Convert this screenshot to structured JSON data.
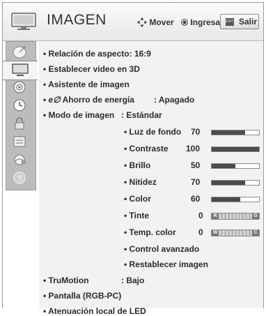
{
  "header": {
    "title": "IMAGEN",
    "move_label": "Mover",
    "enter_label": "Ingresar",
    "exit_key": "EXIT",
    "exit_label": "Salir"
  },
  "sidebar": {
    "items": [
      {
        "icon": "satellite-dish-icon"
      },
      {
        "icon": "tv-picture-icon",
        "active": true
      },
      {
        "icon": "speaker-icon"
      },
      {
        "icon": "clock-icon"
      },
      {
        "icon": "lock-icon"
      },
      {
        "icon": "input-icon"
      },
      {
        "icon": "network-icon"
      },
      {
        "icon": "help-icon",
        "glyph": "?"
      }
    ]
  },
  "menu": {
    "aspect": {
      "label": "Relación de aspecto",
      "sep": ":",
      "value": "16:9"
    },
    "video3d": {
      "label": "Establecer video en 3D"
    },
    "assistant": {
      "label": "Asistente de imagen"
    },
    "energy": {
      "glyph": "e∅",
      "label": "Ahorro de energía",
      "sep": ":",
      "value": "Apagado"
    },
    "mode": {
      "label": "Modo de imagen",
      "sep": ":",
      "value": "Estándar"
    },
    "backlight": {
      "label": "Luz de fondo",
      "value": "70",
      "level": 0.7
    },
    "contrast": {
      "label": "Contraste",
      "value": "100",
      "level": 1.0
    },
    "brightness": {
      "label": "Brillo",
      "value": "50",
      "level": 0.5
    },
    "sharpness": {
      "label": "Nitidez",
      "value": "70",
      "level": 0.7
    },
    "color": {
      "label": "Color",
      "value": "60",
      "level": 0.6
    },
    "tint": {
      "label": "Tinte",
      "value": "0",
      "left": "R",
      "right": "G"
    },
    "temp": {
      "label": "Temp. color",
      "value": "0",
      "left": "W",
      "right": "C"
    },
    "advanced": {
      "label": "Control avanzado"
    },
    "reset": {
      "label": "Restablecer imagen"
    },
    "trumotion": {
      "label": "TruMotion",
      "sep": ":",
      "value": "Bajo"
    },
    "screen": {
      "label": "Pantalla (RGB-PC)"
    },
    "dimming": {
      "label": "Atenuación local de LED"
    }
  },
  "colors": {
    "bar_fill": "#4b4b4b",
    "content_bg": "#f2f2f2",
    "sidebar_bg": "#bcbcbc"
  }
}
